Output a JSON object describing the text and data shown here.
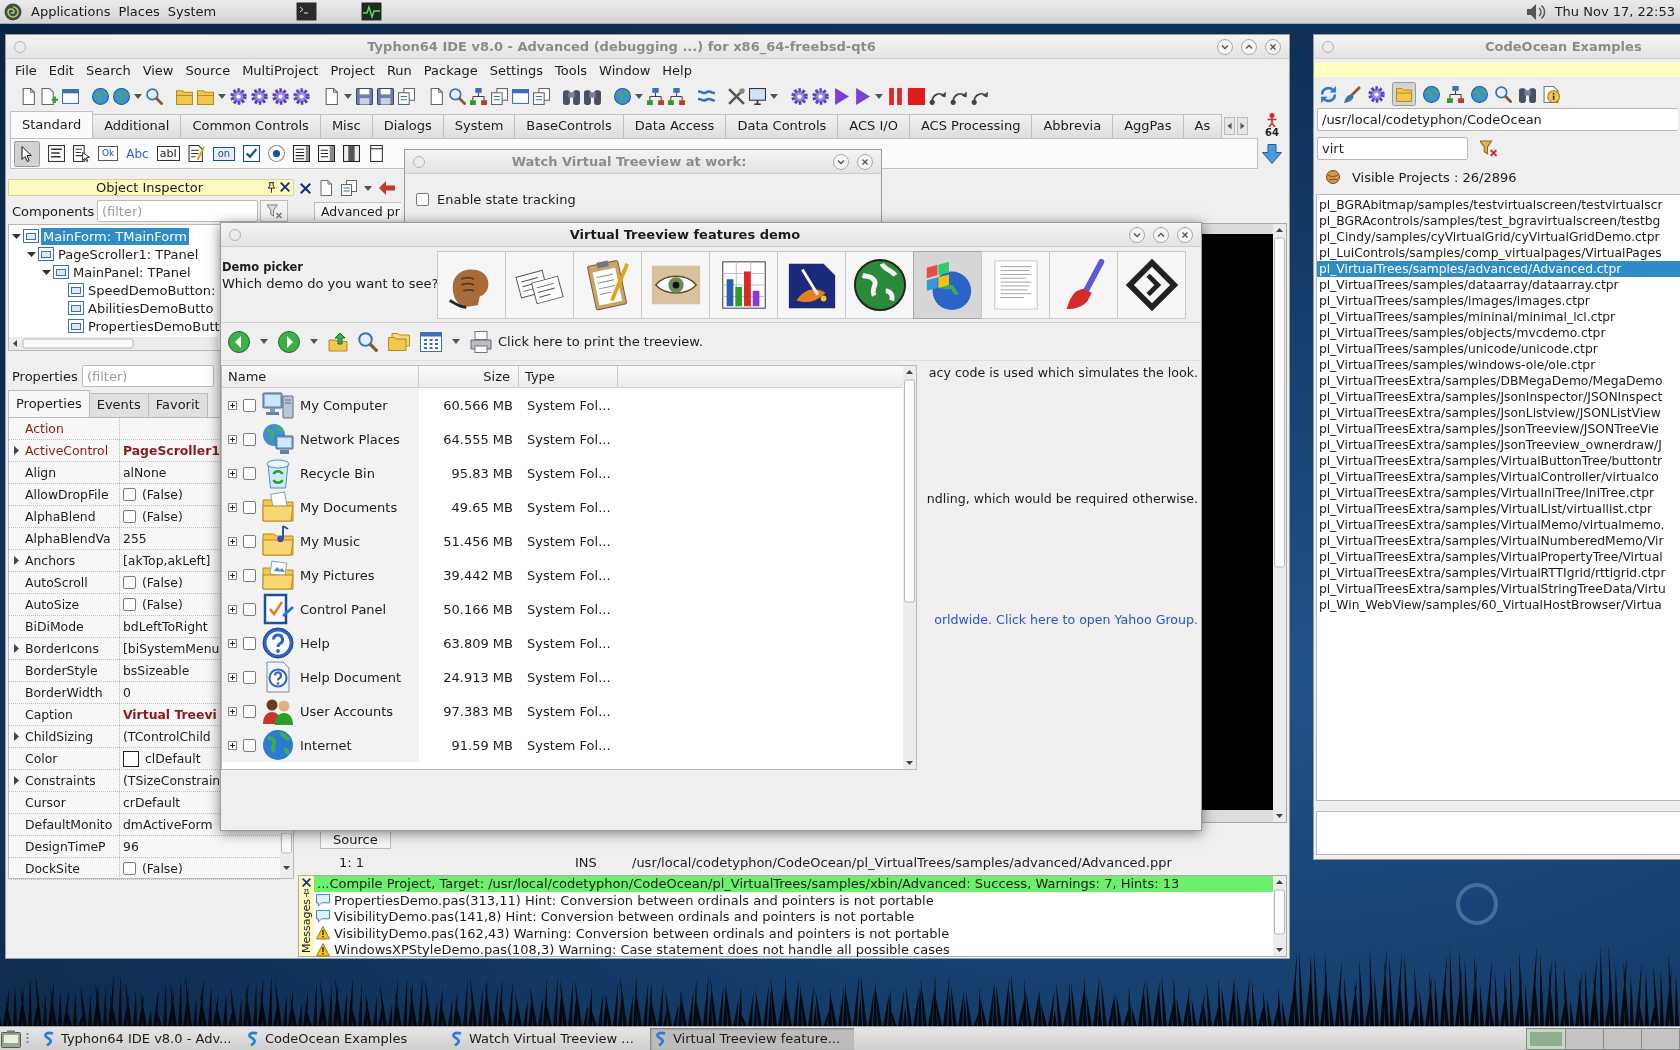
{
  "top_panel": {
    "menus": [
      "Applications",
      "Places",
      "System"
    ],
    "clock": "Thu Nov 17, 22:53"
  },
  "ide_window": {
    "title": "Typhon64 IDE v8.0 - Advanced (debugging ...) for x86_64-freebsd-qt6",
    "active": false,
    "menu": [
      "File",
      "Edit",
      "Search",
      "View",
      "Source",
      "MultiProject",
      "Project",
      "Run",
      "Package",
      "Settings",
      "Tools",
      "Window",
      "Help"
    ],
    "palette": {
      "tabs": [
        {
          "label": "Standard",
          "selected": true
        },
        {
          "label": "Additional",
          "selected": false
        },
        {
          "label": "Common Controls",
          "selected": false
        },
        {
          "label": "Misc",
          "selected": false
        },
        {
          "label": "Dialogs",
          "selected": false
        },
        {
          "label": "System",
          "selected": false
        },
        {
          "label": "BaseControls",
          "selected": false
        },
        {
          "label": "Data Access",
          "selected": false
        },
        {
          "label": "Data Controls",
          "selected": false
        },
        {
          "label": "ACS I/O",
          "selected": false
        },
        {
          "label": "ACS Processing",
          "selected": false
        },
        {
          "label": "Abbrevia",
          "selected": false
        },
        {
          "label": "AggPas",
          "selected": false
        },
        {
          "label": "As",
          "selected": false
        }
      ],
      "components": [
        {
          "kind": "pointer",
          "selected": true
        },
        {
          "kind": "main-menu",
          "selected": false
        },
        {
          "kind": "popup-menu",
          "selected": false
        },
        {
          "kind": "button",
          "label": "Ok",
          "selected": false
        },
        {
          "kind": "label",
          "label": "Abc",
          "selected": false
        },
        {
          "kind": "edit",
          "label": "abI",
          "selected": false
        },
        {
          "kind": "memo",
          "selected": false
        },
        {
          "kind": "toggle",
          "label": "on",
          "selected": false
        },
        {
          "kind": "checkbox",
          "selected": false
        },
        {
          "kind": "radio",
          "selected": false
        },
        {
          "kind": "listbox",
          "selected": false
        },
        {
          "kind": "combobox",
          "selected": false
        },
        {
          "kind": "scrollbar",
          "selected": false
        },
        {
          "kind": "groupbox",
          "selected": false
        }
      ],
      "badge": "64"
    },
    "object_inspector": {
      "title": "Object Inspector",
      "components_label": "Components",
      "components_filter": {
        "placeholder": "(filter)"
      },
      "tree": [
        {
          "label": "MainForm: TMainForm",
          "selected": true,
          "expanded": true,
          "children": [
            {
              "label": "PageScroller1: TPanel",
              "selected": false,
              "expanded": true,
              "children": [
                {
                  "label": "MainPanel: TPanel",
                  "selected": false,
                  "expanded": true,
                  "children": [
                    {
                      "label": "SpeedDemoButton:",
                      "selected": false
                    },
                    {
                      "label": "AbilitiesDemoButto",
                      "selected": false
                    },
                    {
                      "label": "PropertiesDemoButt",
                      "selected": false
                    }
                  ]
                }
              ]
            }
          ]
        }
      ],
      "properties_label": "Properties",
      "properties_filter": {
        "placeholder": "(filter)"
      },
      "tabs": [
        {
          "label": "Properties",
          "selected": true
        },
        {
          "label": "Events",
          "selected": false
        },
        {
          "label": "Favorit",
          "selected": false
        }
      ],
      "properties": [
        {
          "name": "Action",
          "kind": "reference"
        },
        {
          "name": "ActiveControl",
          "kind": "reference",
          "value": "PageScroller1",
          "modified": true,
          "expanded": false
        },
        {
          "name": "Align",
          "kind": "text",
          "value": "alNone",
          "modified": false
        },
        {
          "name": "AllowDropFile",
          "kind": "bool",
          "value": "(False)",
          "checked": false,
          "modified": false
        },
        {
          "name": "AlphaBlend",
          "kind": "bool",
          "value": "(False)",
          "checked": false,
          "modified": false
        },
        {
          "name": "AlphaBlendVa",
          "kind": "text",
          "value": "255",
          "modified": false
        },
        {
          "name": "Anchors",
          "kind": "text",
          "value": "[akTop,akLeft]",
          "modified": false,
          "expanded": false
        },
        {
          "name": "AutoScroll",
          "kind": "bool",
          "value": "(False)",
          "checked": false,
          "modified": false
        },
        {
          "name": "AutoSize",
          "kind": "bool",
          "value": "(False)",
          "checked": false,
          "modified": false
        },
        {
          "name": "BiDiMode",
          "kind": "text",
          "value": "bdLeftToRight",
          "modified": false
        },
        {
          "name": "BorderIcons",
          "kind": "text",
          "value": "[biSystemMenu",
          "modified": false,
          "expanded": false
        },
        {
          "name": "BorderStyle",
          "kind": "text",
          "value": "bsSizeable",
          "modified": false
        },
        {
          "name": "BorderWidth",
          "kind": "text",
          "value": "0",
          "modified": false
        },
        {
          "name": "Caption",
          "kind": "text",
          "value": "Virtual Treevi",
          "modified": true
        },
        {
          "name": "ChildSizing",
          "kind": "text",
          "value": "(TControlChild",
          "modified": false,
          "expanded": false
        },
        {
          "name": "Color",
          "kind": "color",
          "value": "clDefault",
          "modified": false
        },
        {
          "name": "Constraints",
          "kind": "text",
          "value": "(TSizeConstrain",
          "modified": false,
          "expanded": false
        },
        {
          "name": "Cursor",
          "kind": "text",
          "value": "crDefault",
          "modified": false
        },
        {
          "name": "DefaultMonito",
          "kind": "text",
          "value": "dmActiveForm",
          "modified": false
        },
        {
          "name": "DesignTimeP",
          "kind": "text",
          "value": "96",
          "modified": false
        },
        {
          "name": "DockSite",
          "kind": "bool",
          "value": "(False)",
          "checked": false,
          "modified": false
        }
      ]
    },
    "editor": {
      "tab": "Advanced pr",
      "source_tab": "Source",
      "status": {
        "position": "1: 1",
        "mode": "INS",
        "file": "/usr/local/codetyphon/CodeOcean/pl_VirtualTrees/samples/advanced/Advanced.ppr"
      }
    },
    "messages": {
      "label": "Messages",
      "items": [
        {
          "kind": "success",
          "text": "...Compile Project, Target: /usr/local/codetyphon/CodeOcean/pl_VirtualTrees/samples/xbin/Advanced: Success, Warnings: 7, Hints: 13"
        },
        {
          "kind": "hint",
          "text": "PropertiesDemo.pas(313,11) Hint: Conversion between ordinals and pointers is not portable"
        },
        {
          "kind": "hint",
          "text": "VisibilityDemo.pas(141,8) Hint: Conversion between ordinals and pointers is not portable"
        },
        {
          "kind": "warning",
          "text": "VisibilityDemo.pas(162,43) Warning: Conversion between ordinals and pointers is not portable"
        },
        {
          "kind": "warning",
          "text": "WindowsXPStyleDemo.pas(108,3) Warning: Case statement does not handle all possible cases"
        }
      ]
    }
  },
  "watch_window": {
    "title": "Watch Virtual Treeview at work:",
    "active": false,
    "state_tracking": {
      "label": "Enable state tracking",
      "checked": false
    }
  },
  "demo_window": {
    "title": "Virtual Treeview features demo",
    "active": true,
    "picker_title": "Demo picker",
    "picker_prompt": "Which demo do you want to see?",
    "demos": [
      {
        "kind": "fist",
        "selected": false
      },
      {
        "kind": "papers",
        "selected": false
      },
      {
        "kind": "clipboard",
        "selected": false
      },
      {
        "kind": "eye",
        "selected": false
      },
      {
        "kind": "chart",
        "selected": false
      },
      {
        "kind": "paint",
        "selected": false
      },
      {
        "kind": "globe",
        "selected": false
      },
      {
        "kind": "flag-globe",
        "selected": true
      },
      {
        "kind": "document",
        "selected": false
      },
      {
        "kind": "brush",
        "selected": false
      },
      {
        "kind": "diamond",
        "selected": false
      }
    ],
    "print_label": "Click here to print the treeview.",
    "columns": [
      "Name",
      "Size",
      "Type"
    ],
    "rows": [
      {
        "kind": "computer",
        "name": "My Computer",
        "size": "60.566 MB",
        "type": "System Fol...",
        "checked": false,
        "expanded": false
      },
      {
        "kind": "network",
        "name": "Network Places",
        "size": "64.555 MB",
        "type": "System Fol...",
        "checked": false,
        "expanded": false
      },
      {
        "kind": "recycle-bin",
        "name": "Recycle Bin",
        "size": "95.83 MB",
        "type": "System Fol...",
        "checked": false,
        "expanded": false
      },
      {
        "kind": "documents",
        "name": "My Documents",
        "size": "49.65 MB",
        "type": "System Fol...",
        "checked": false,
        "expanded": false
      },
      {
        "kind": "music",
        "name": "My Music",
        "size": "51.456 MB",
        "type": "System Fol...",
        "checked": false,
        "expanded": false
      },
      {
        "kind": "pictures",
        "name": "My Pictures",
        "size": "39.442 MB",
        "type": "System Fol...",
        "checked": false,
        "expanded": false
      },
      {
        "kind": "control-panel",
        "name": "Control Panel",
        "size": "50.166 MB",
        "type": "System Fol...",
        "checked": false,
        "expanded": false
      },
      {
        "kind": "help",
        "name": "Help",
        "size": "63.809 MB",
        "type": "System Fol...",
        "checked": false,
        "expanded": false
      },
      {
        "kind": "help-document",
        "name": "Help Document",
        "size": "24.913 MB",
        "type": "System Fol...",
        "checked": false,
        "expanded": false
      },
      {
        "kind": "users",
        "name": "User Accounts",
        "size": "97.383 MB",
        "type": "System Fol...",
        "checked": false,
        "expanded": false
      },
      {
        "kind": "internet",
        "name": "Internet",
        "size": "91.59 MB",
        "type": "System Fol...",
        "checked": false,
        "expanded": false
      }
    ],
    "notes": [
      {
        "kind": "text",
        "text": "acy code is used which simulates the look."
      },
      {
        "kind": "text",
        "text": "ndling, which would be required otherwise."
      },
      {
        "kind": "link",
        "text": "orldwide. Click here to open Yahoo Group."
      }
    ]
  },
  "codeocean_window": {
    "title": "CodeOcean Examples",
    "active": false,
    "toolbar": [
      {
        "kind": "refresh",
        "pressed": false
      },
      {
        "kind": "brush",
        "pressed": false
      },
      {
        "kind": "gear",
        "pressed": false
      },
      {
        "kind": "folder",
        "pressed": true
      },
      {
        "kind": "globe",
        "pressed": false
      },
      {
        "kind": "hierarchy",
        "pressed": false
      },
      {
        "kind": "globe",
        "pressed": false
      },
      {
        "kind": "search",
        "pressed": false
      },
      {
        "kind": "binoculars",
        "pressed": false
      },
      {
        "kind": "info",
        "pressed": false
      }
    ],
    "path": "/usr/local/codetyphon/CodeOcean",
    "filter": "virt",
    "count": "Visible Projects : 26/2896",
    "projects": [
      {
        "path": "pl_BGRAbitmap/samples/testvirtualscreen/testvirtualscr",
        "selected": false
      },
      {
        "path": "pl_BGRAcontrols/samples/test_bgravirtualscreen/testbg",
        "selected": false
      },
      {
        "path": "pl_Cindy/samples/cyVirtualGrid/cyVirtualGridDemo.ctpr",
        "selected": false
      },
      {
        "path": "pl_LuiControls/samples/comp_virtualpages/VirtualPages",
        "selected": false
      },
      {
        "path": "pl_VirtualTrees/samples/advanced/Advanced.ctpr",
        "selected": true
      },
      {
        "path": "pl_VirtualTrees/samples/dataarray/dataarray.ctpr",
        "selected": false
      },
      {
        "path": "pl_VirtualTrees/samples/images/images.ctpr",
        "selected": false
      },
      {
        "path": "pl_VirtualTrees/samples/mininal/minimal_lcl.ctpr",
        "selected": false
      },
      {
        "path": "pl_VirtualTrees/samples/objects/mvcdemo.ctpr",
        "selected": false
      },
      {
        "path": "pl_VirtualTrees/samples/unicode/unicode.ctpr",
        "selected": false
      },
      {
        "path": "pl_VirtualTrees/samples/windows-ole/ole.ctpr",
        "selected": false
      },
      {
        "path": "pl_VirtualTreesExtra/samples/DBMegaDemo/MegaDemo",
        "selected": false
      },
      {
        "path": "pl_VirtualTreesExtra/samples/JsonInspector/JSONInspect",
        "selected": false
      },
      {
        "path": "pl_VirtualTreesExtra/samples/JsonListview/JSONListView",
        "selected": false
      },
      {
        "path": "pl_VirtualTreesExtra/samples/JsonTreeview/JSONTreeVie",
        "selected": false
      },
      {
        "path": "pl_VirtualTreesExtra/samples/JsonTreeview_ownerdraw/J",
        "selected": false
      },
      {
        "path": "pl_VirtualTreesExtra/samples/VirtualButtonTree/buttontr",
        "selected": false
      },
      {
        "path": "pl_VirtualTreesExtra/samples/VirtualController/virtualco",
        "selected": false
      },
      {
        "path": "pl_VirtualTreesExtra/samples/VirtualIniTree/IniTree.ctpr",
        "selected": false
      },
      {
        "path": "pl_VirtualTreesExtra/samples/VirtualList/virtuallist.ctpr",
        "selected": false
      },
      {
        "path": "pl_VirtualTreesExtra/samples/VirtualMemo/virtualmemo.",
        "selected": false
      },
      {
        "path": "pl_VirtualTreesExtra/samples/VirtualNumberedMemo/Vir",
        "selected": false
      },
      {
        "path": "pl_VirtualTreesExtra/samples/VirtualPropertyTree/Virtual",
        "selected": false
      },
      {
        "path": "pl_VirtualTreesExtra/samples/VirtualRTTIgrid/rttigrid.ctpr",
        "selected": false
      },
      {
        "path": "pl_VirtualTreesExtra/samples/VirtualStringTreeData/Virtu",
        "selected": false
      },
      {
        "path": "pl_Win_WebView/samples/60_VirtualHostBrowser/Virtua",
        "selected": false
      }
    ]
  },
  "taskbar": {
    "tasks": [
      {
        "label": "Typhon64 IDE v8.0 - Adv...",
        "selected": false
      },
      {
        "label": "CodeOcean Examples",
        "selected": false
      },
      {
        "label": "Watch Virtual Treeview ...",
        "selected": false
      },
      {
        "label": "Virtual Treeview feature...",
        "selected": true
      }
    ],
    "workspaces": [
      {
        "selected": true
      },
      {
        "selected": false
      },
      {
        "selected": false
      },
      {
        "selected": false
      }
    ]
  }
}
